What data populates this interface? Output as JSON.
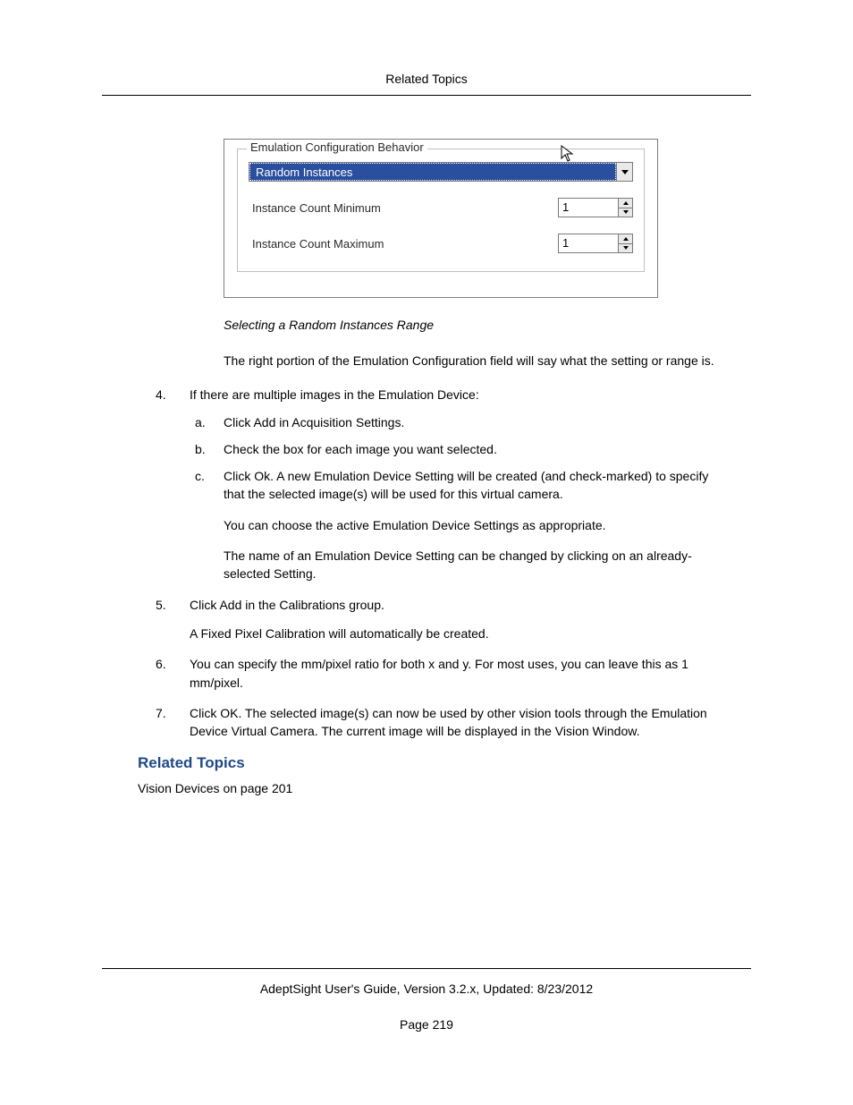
{
  "header": {
    "title": "Related Topics"
  },
  "screenshot": {
    "legend": "Emulation Configuration Behavior",
    "combo_value": "Random Instances",
    "rows": [
      {
        "label": "Instance Count Minimum",
        "value": "1"
      },
      {
        "label": "Instance Count Maximum",
        "value": "1"
      }
    ]
  },
  "caption": "Selecting a Random Instances Range",
  "para1": "The right portion of the Emulation Configuration field will say what the setting or range is.",
  "step4": {
    "num": "4.",
    "text": "If there are multiple images in the Emulation Device:",
    "a": {
      "num": "a.",
      "text": "Click Add in Acquisition Settings."
    },
    "b": {
      "num": "b.",
      "text": "Check the box for each image you want selected."
    },
    "c": {
      "num": "c.",
      "text": "Click Ok. A new Emulation Device Setting will be created (and check-marked) to specify that the selected image(s) will be used for this virtual camera.",
      "p1": "You can choose the active Emulation Device Settings as appropriate.",
      "p2": "The name of an Emulation Device Setting can be changed by clicking on an already-selected Setting."
    }
  },
  "step5": {
    "num": "5.",
    "text": "Click Add in the Calibrations group.",
    "p1": "A Fixed Pixel Calibration will automatically be created."
  },
  "step6": {
    "num": "6.",
    "text": "You can specify the mm/pixel ratio for both x and y. For most uses, you can leave this as 1 mm/pixel."
  },
  "step7": {
    "num": "7.",
    "text": "Click OK. The selected image(s) can now be used by other vision tools through the Emulation Device Virtual Camera. The current image will be displayed in the Vision Window."
  },
  "related": {
    "heading": "Related Topics",
    "link": "Vision Devices on page 201"
  },
  "footer": {
    "line1": "AdeptSight User's Guide,  Version 3.2.x, Updated: 8/23/2012",
    "line2": "Page 219"
  }
}
